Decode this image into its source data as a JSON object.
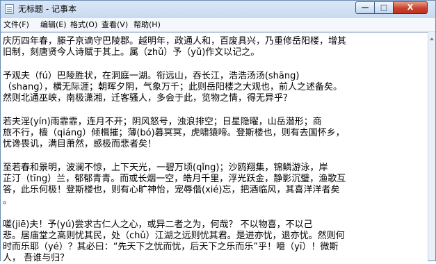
{
  "window": {
    "title": "无标题 - 记事本",
    "minimize_label": "—",
    "maximize_label": "□",
    "close_label": "X"
  },
  "menu": {
    "items": [
      {
        "label": "文件(F)"
      },
      {
        "label": "编辑(E)"
      },
      {
        "label": "格式(O)"
      },
      {
        "label": "查看(V)"
      },
      {
        "label": "帮助(H)"
      }
    ]
  },
  "document": {
    "lines": [
      "庆历四年春，滕子京谪守巴陵郡。越明年，政通人和，百废具兴，乃重修岳阳楼，增其",
      "旧制，刻唐贤今人诗赋于其上。属（zhǔ）予（yǔ)作文以记之。",
      "",
      "    予观夫（fú）巴陵胜状，在洞庭一湖。衔远山，吞长江，浩浩汤汤(shāng)",
      "（shang），横无际涯；朝晖夕阴，气象万千；此则岳阳楼之大观也，前人之述备矣。",
      "然则北通巫峡，南极潇湘，迁客骚人，多会于此，览物之情，得无异乎？",
      "",
      "    若夫淫(yín)雨霏霏，连月不开；阴风怒号，浊浪排空；日星隐曜，山岳潜形；商",
      "旅不行，樯（qiáng）倾楫摧；薄(bó)暮冥冥，虎啸猿啼。登斯楼也，则有去国怀乡，",
      "忧谗畏讥，满目萧然，感极而悲者矣！",
      "",
      "    至若春和景明，波澜不惊，上下天光，一碧万顷(qǐng)；沙鸥翔集，锦鳞游泳，岸",
      "芷汀（tīng）兰，郁郁青青。而或长烟一空，皓月千里，浮光跃金，静影沉璧，渔歌互",
      "答，此乐何极！登斯楼也，则有心旷神怡，宠辱偕(xié)忘，把酒临风，其喜洋洋者矣",
      "。",
      "",
      "    嗟(jiē)夫！予(yú)尝求古仁人之心，或异二者之为，何哉？  不以物喜，不以己",
      "悲。居庙堂之高则忧其民，处（chǔ）江湖之远则忧其君。是进亦忧，退亦忧。然则何",
      "时而乐耶（yé）？其必曰：“先天下之忧而忧，后天下之乐而乐”乎！噫（yī）！微斯",
      "人，  吾谁与归？"
    ]
  }
}
